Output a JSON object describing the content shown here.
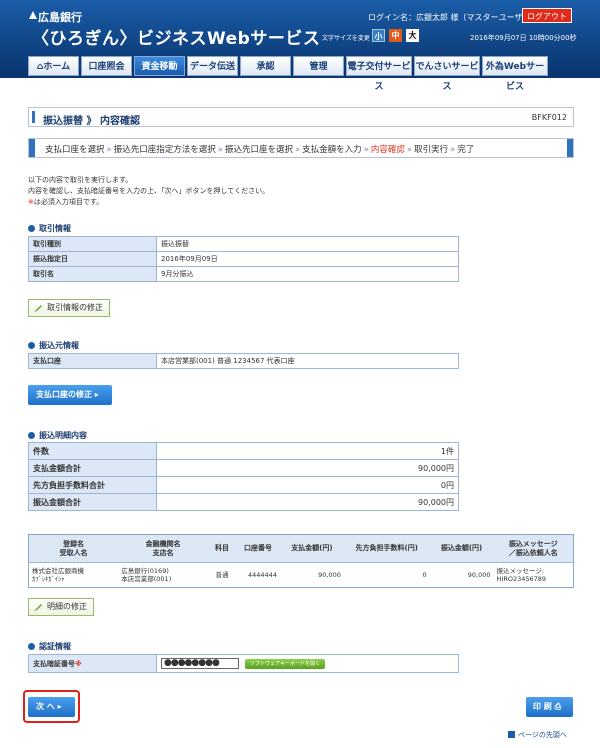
{
  "header": {
    "bank_name": "広島銀行",
    "service_name": "〈ひろぎん〉ビジネスWebサービス",
    "login_name": "ログイン名：広銀太郎 様（マスターユーザ）",
    "logout_label": "ログアウト",
    "font_size_label": "文字サイズを変更",
    "font_small": "小",
    "font_mid": "中",
    "font_big": "大",
    "datetime": "2016年09月07日 10時00分00秒"
  },
  "nav": [
    "ホーム",
    "口座照会",
    "資金移動",
    "データ伝送",
    "承認",
    "管理",
    "電子交付サービス",
    "でんさいサービス",
    "外為Webサービス"
  ],
  "page": {
    "title": "振込振替 》 内容確認",
    "code": "BFKF012"
  },
  "steps": [
    "支払口座を選択",
    "振込先口座指定方法を選択",
    "振込先口座を選択",
    "支払金額を入力",
    "内容確認",
    "取引実行",
    "完了"
  ],
  "intro": {
    "line1": "以下の内容で取引を実行します。",
    "line2": "内容を確認し、支払暗証番号を入力の上、「次へ」ボタンを押してください。",
    "line3_mark": "※",
    "line3": "は必須入力項目です。"
  },
  "sections": {
    "trade_info": "取引情報",
    "source_info": "振込元情報",
    "detail": "振込明細内容",
    "auth": "認証情報"
  },
  "trade_info": [
    {
      "k": "取引種別",
      "v": "振込振替"
    },
    {
      "k": "振込指定日",
      "v": "2016年09月09日"
    },
    {
      "k": "取引名",
      "v": "9月分振込"
    }
  ],
  "edit_trade_label": "取引情報の修正",
  "source_info": {
    "k": "支払口座",
    "v": "本店営業部(001) 普通 1234567 代表口座"
  },
  "edit_source_label": "支払口座の修正 ▸",
  "summary": [
    {
      "k": "件数",
      "v": "1件"
    },
    {
      "k": "支払金額合計",
      "v": "90,000円"
    },
    {
      "k": "先方負担手数料合計",
      "v": "0円"
    },
    {
      "k": "振込金額合計",
      "v": "90,000円"
    }
  ],
  "detail_table": {
    "headers": [
      "登録名\n受取人名",
      "金融機関名\n支店名",
      "科目",
      "口座番号",
      "支払金額(円)",
      "先方負担手数料(円)",
      "振込金額(円)",
      "振込メッセージ\n／振込依頼人名"
    ],
    "row": {
      "name1": "株式会社広銀商機",
      "name2": "ｶﾌﾞｼｷｶﾞｲｼｬ",
      "bank1": "広島銀行(0169)",
      "bank2": "本店営業部(001)",
      "type": "普通",
      "account": "4444444",
      "pay": "90,000",
      "fee": "0",
      "transfer": "90,000",
      "msg1": "振込メッセージ:",
      "msg2": "HIRO23456789"
    }
  },
  "edit_detail_label": "明細の修正",
  "auth": {
    "label": "支払暗証番号",
    "mark": "※",
    "value": "●●●●●●●●",
    "keyboard_label": "ソフトウェアキーボードを開く"
  },
  "next_label": "次 へ ▸",
  "print_label": "印 刷",
  "pagetop_label": "ページの先頭へ",
  "colors": {
    "accent": "#1a5ea8",
    "current_step": "#e03020",
    "highlight_border": "#e0201a"
  }
}
